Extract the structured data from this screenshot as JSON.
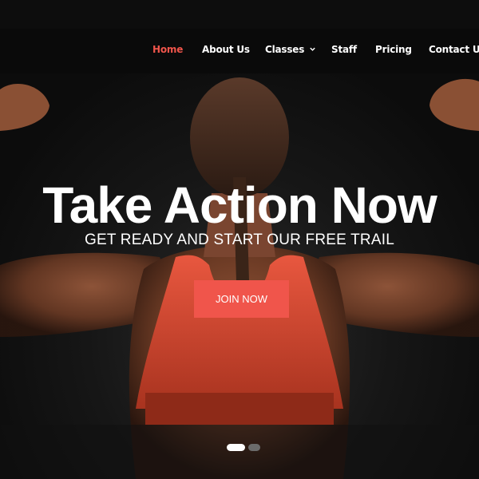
{
  "nav": {
    "items": [
      {
        "label": "Home",
        "active": true
      },
      {
        "label": "About Us"
      },
      {
        "label": "Classes",
        "has_dropdown": true
      },
      {
        "label": "Staff"
      },
      {
        "label": "Pricing"
      },
      {
        "label": "Contact Us"
      }
    ],
    "dropdown_icon": "chevron-down-icon"
  },
  "hero": {
    "title": "Take Action Now",
    "subtitle": "GET READY AND START OUR FREE TRAIL",
    "cta_label": "JOIN NOW",
    "slide_count": 2,
    "active_slide": 1
  },
  "colors": {
    "accent": "#f0554b",
    "background": "#0b0b0b",
    "text": "#ffffff"
  }
}
